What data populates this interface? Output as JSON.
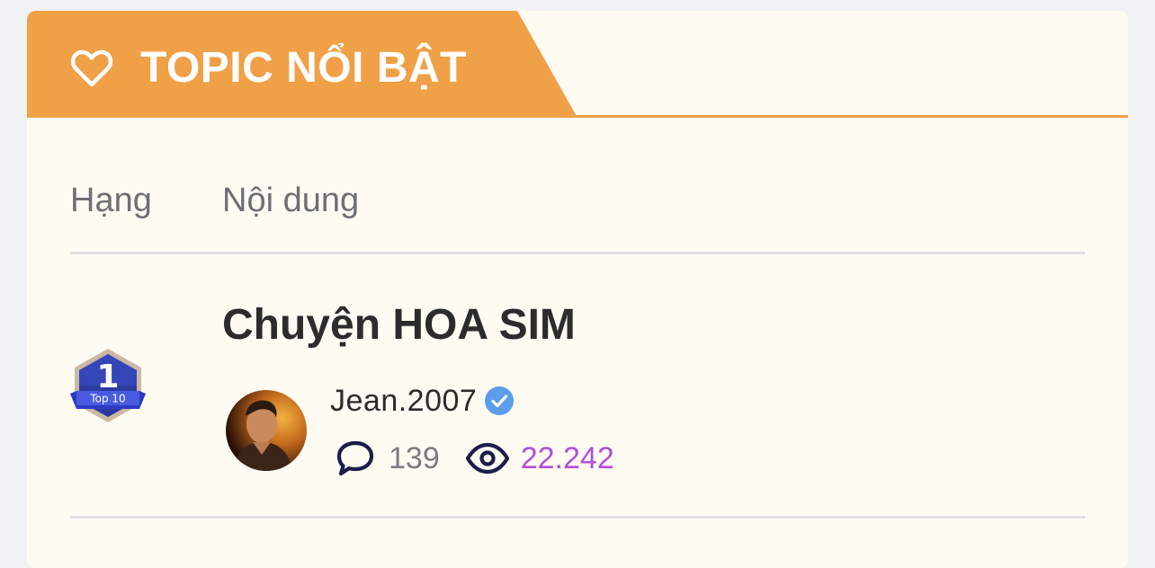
{
  "section": {
    "title": "TOPIC NỔI BẬT",
    "icon": "heart-outline-icon",
    "accent_color": "#f0a046"
  },
  "table": {
    "columns": [
      "Hạng",
      "Nội dung"
    ]
  },
  "topics": [
    {
      "rank": "1",
      "rank_label": "Top 10",
      "title": "Chuyện HOA SIM",
      "author": "Jean.2007",
      "verified": true,
      "replies": "139",
      "views": "22.242",
      "views_color": "#b14fd9"
    }
  ]
}
